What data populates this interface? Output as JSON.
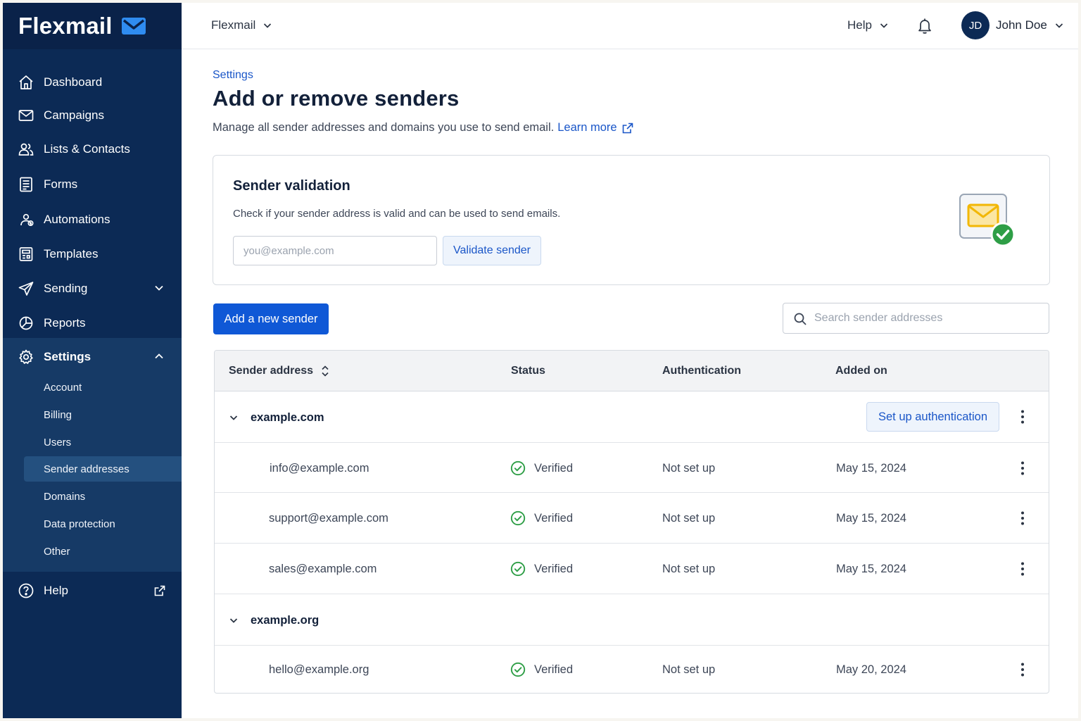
{
  "brand": {
    "name": "Flexmail",
    "accent": "#0f58d6",
    "sidebar_bg": "#0c2a55"
  },
  "topbar": {
    "workspace": "Flexmail",
    "help": "Help",
    "avatar_initials": "JD",
    "user_name": "John Doe"
  },
  "sidebar": {
    "items": [
      {
        "label": "Dashboard",
        "icon": "home-icon"
      },
      {
        "label": "Campaigns",
        "icon": "envelope-icon"
      },
      {
        "label": "Lists & Contacts",
        "icon": "users-icon"
      },
      {
        "label": "Forms",
        "icon": "form-icon"
      },
      {
        "label": "Automations",
        "icon": "automation-icon"
      },
      {
        "label": "Templates",
        "icon": "template-icon"
      },
      {
        "label": "Sending",
        "icon": "paper-plane-icon"
      },
      {
        "label": "Reports",
        "icon": "reports-icon"
      },
      {
        "label": "Settings",
        "icon": "gear-icon"
      }
    ],
    "settings_sub": [
      "Account",
      "Billing",
      "Users",
      "Sender addresses",
      "Domains",
      "Data protection",
      "Other"
    ],
    "active_sub": "Sender addresses",
    "help": "Help"
  },
  "page": {
    "breadcrumb": "Settings",
    "title": "Add or remove senders",
    "description": "Manage all sender addresses and domains you use to send email.",
    "learn_more": "Learn more"
  },
  "validation": {
    "title": "Sender validation",
    "description": "Check if your sender address is valid and can be used to send emails.",
    "input_placeholder": "you@example.com",
    "button": "Validate sender"
  },
  "actions": {
    "add_sender": "Add a new sender",
    "search_placeholder": "Search sender addresses"
  },
  "table": {
    "columns": [
      "Sender address",
      "Status",
      "Authentication",
      "Added on"
    ],
    "groups": [
      {
        "domain": "example.com",
        "action": "Set up authentication",
        "senders": [
          {
            "address": "info@example.com",
            "status": "Verified",
            "auth": "Not set up",
            "added": "May 15, 2024"
          },
          {
            "address": "support@example.com",
            "status": "Verified",
            "auth": "Not set up",
            "added": "May 15, 2024"
          },
          {
            "address": "sales@example.com",
            "status": "Verified",
            "auth": "Not set up",
            "added": "May 15, 2024"
          }
        ]
      },
      {
        "domain": "example.org",
        "senders": [
          {
            "address": "hello@example.org",
            "status": "Verified",
            "auth": "Not set up",
            "added": "May 20, 2024"
          }
        ]
      }
    ]
  }
}
